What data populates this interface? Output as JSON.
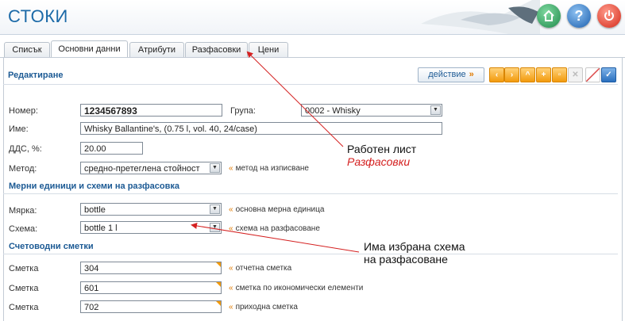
{
  "app": {
    "title": "СТОКИ"
  },
  "tabs": [
    {
      "label": "Списък"
    },
    {
      "label": "Основни данни"
    },
    {
      "label": "Атрибути"
    },
    {
      "label": "Разфасовки"
    },
    {
      "label": "Цени"
    }
  ],
  "edit": {
    "title": "Редактиране",
    "action_label": "действие"
  },
  "form": {
    "number": {
      "label": "Номер:",
      "value": "1234567893"
    },
    "group": {
      "label": "Група:",
      "value": "0002 - Whisky"
    },
    "name": {
      "label": "Име:",
      "value": "Whisky Ballantine's, (0.75 l, vol. 40, 24/case)"
    },
    "vat": {
      "label": "ДДС, %:",
      "value": "20.00"
    },
    "method": {
      "label": "Метод:",
      "value": "средно-претеглена стойност",
      "hint": "метод на изписване"
    }
  },
  "units": {
    "title": "Мерни единици и схеми на разфасовка",
    "measure": {
      "label": "Мярка:",
      "value": "bottle",
      "hint": "основна мерна единица"
    },
    "scheme": {
      "label": "Схема:",
      "value": "bottle 1 l",
      "hint": "схема на разфасоване"
    }
  },
  "accounts": {
    "title": "Счетоводни сметки",
    "rows": [
      {
        "label": "Сметка",
        "value": "304",
        "hint": "отчетна сметка"
      },
      {
        "label": "Сметка",
        "value": "601",
        "hint": "сметка по икономически елементи"
      },
      {
        "label": "Сметка",
        "value": "702",
        "hint": "приходна сметка"
      }
    ]
  },
  "annotations": {
    "worksheet_line1": "Работен лист",
    "worksheet_line2": "Разфасовки",
    "scheme_line1": "Има избрана схема",
    "scheme_line2": "на разфасоване"
  },
  "colors": {
    "accent": "#1c6aa8",
    "orange": "#f29a0c",
    "annotation_arrow": "#d42020"
  }
}
